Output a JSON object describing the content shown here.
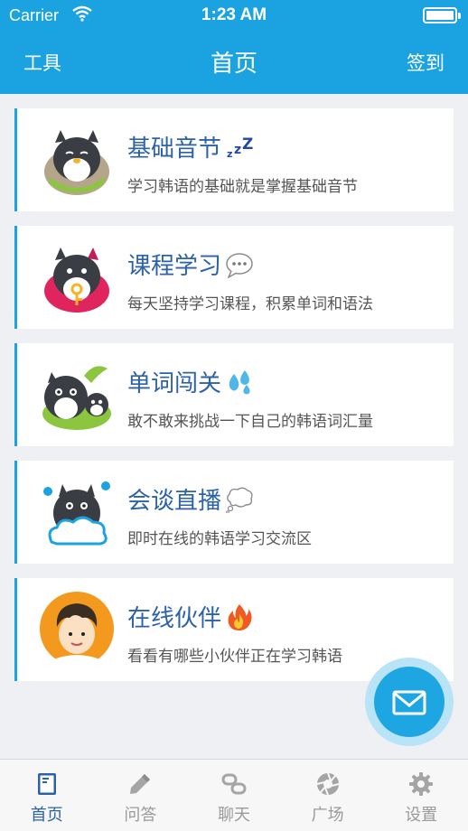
{
  "status_bar": {
    "carrier": "Carrier",
    "time": "1:23 AM"
  },
  "nav": {
    "left": "工具",
    "title": "首页",
    "right": "签到"
  },
  "cards": [
    {
      "title": "基础音节",
      "subtitle": "学习韩语的基础就是掌握基础音节",
      "emoji_icon": "sleeping-zzz-icon"
    },
    {
      "title": "课程学习",
      "subtitle": "每天坚持学习课程，积累单词和语法",
      "emoji_icon": "speech-bubble-icon"
    },
    {
      "title": "单词闯关",
      "subtitle": "敢不敢来挑战一下自己的韩语词汇量",
      "emoji_icon": "sweat-drops-icon"
    },
    {
      "title": "会谈直播",
      "subtitle": "即时在线的韩语学习交流区",
      "emoji_icon": "thought-bubble-icon"
    },
    {
      "title": "在线伙伴",
      "subtitle": "看看有哪些小伙伴正在学习韩语",
      "emoji_icon": "fire-icon"
    }
  ],
  "fab": {
    "icon": "mail-icon"
  },
  "tabs": [
    {
      "label": "首页",
      "icon": "book-icon",
      "active": true
    },
    {
      "label": "问答",
      "icon": "pencil-icon",
      "active": false
    },
    {
      "label": "聊天",
      "icon": "chat-link-icon",
      "active": false
    },
    {
      "label": "广场",
      "icon": "aperture-icon",
      "active": false
    },
    {
      "label": "设置",
      "icon": "gear-icon",
      "active": false
    }
  ],
  "colors": {
    "primary": "#1aa3e0",
    "title_blue": "#2c62a8",
    "background": "#eef0f4"
  }
}
